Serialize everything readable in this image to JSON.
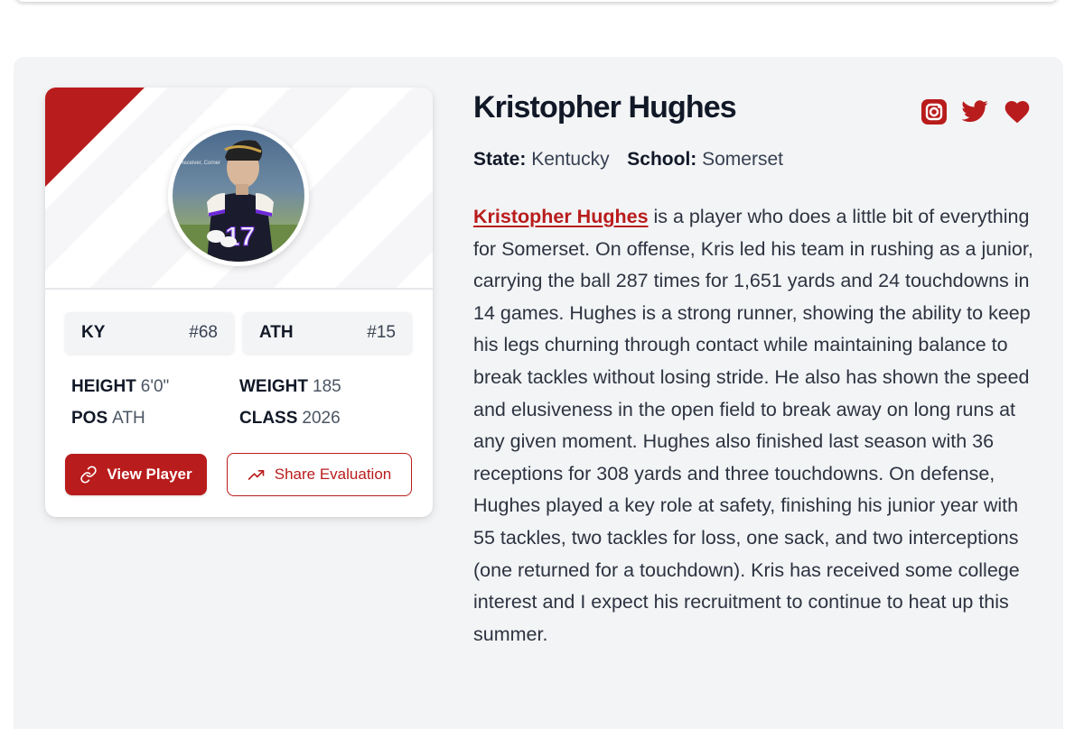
{
  "player": {
    "name": "Kristopher Hughes",
    "state_label": "State:",
    "state": "Kentucky",
    "school_label": "School:",
    "school": "Somerset",
    "photo_caption": "Receiver, Corner",
    "jersey_number": "17"
  },
  "rankings": {
    "state_abbr": "KY",
    "state_rank": "#68",
    "position_abbr": "ATH",
    "position_rank": "#15"
  },
  "attributes": {
    "height_label": "HEIGHT",
    "height": "6'0\"",
    "weight_label": "WEIGHT",
    "weight": "185",
    "pos_label": "POS",
    "pos": "ATH",
    "class_label": "CLASS",
    "class": "2026"
  },
  "buttons": {
    "view_player": "View Player",
    "share_evaluation": "Share Evaluation"
  },
  "bio": {
    "link_text": "Kristopher Hughes",
    "text": " is a player who does a little bit of everything for Somerset. On offense, Kris led his team in rushing as a junior, carrying the ball 287 times for 1,651 yards and 24 touchdowns in 14 games. Hughes is a strong runner, showing the ability to keep his legs churning through contact while maintaining balance to break tackles without losing stride. He also has shown the speed and elusiveness in the open field to break away on long runs at any given moment. Hughes also finished last season with 36 receptions for 308 yards and three touchdowns. On defense, Hughes played a key role at safety, finishing his junior year with 55 tackles, two tackles for loss, one sack, and two interceptions (one returned for a touchdown). Kris has received some college interest and I expect his recruitment to continue to heat up this summer."
  },
  "icons": {
    "instagram": "instagram-icon",
    "twitter": "twitter-icon",
    "favorite": "heart-icon",
    "link": "link-icon",
    "trend": "trending-up-icon"
  },
  "colors": {
    "accent": "#b91c1c",
    "panel_bg": "#f3f4f6",
    "text_dark": "#111827"
  }
}
